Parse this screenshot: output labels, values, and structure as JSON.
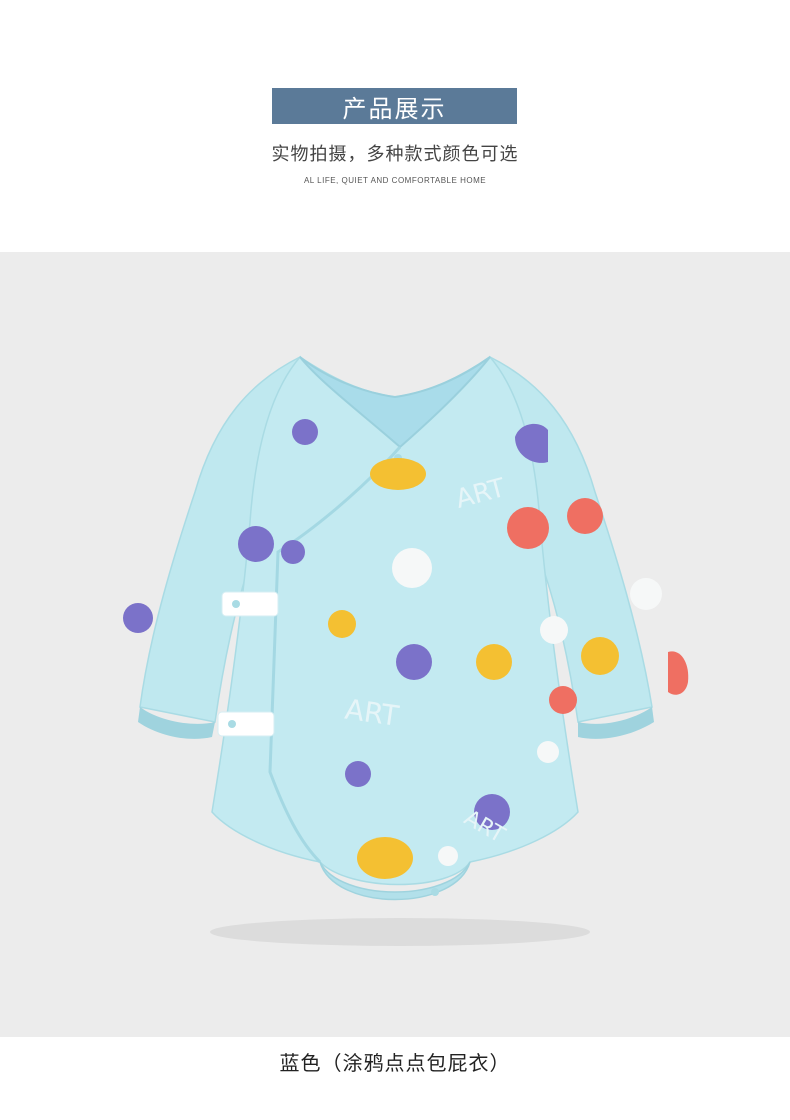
{
  "header": {
    "title": "产品展示",
    "subtitle": "实物拍摄，多种款式颜色可选",
    "tagline": "AL LIFE, QUIET AND COMFORTABLE HOME"
  },
  "product": {
    "caption": "蓝色（涂鸦点点包屁衣）",
    "print_text": "ART"
  },
  "colors": {
    "title_bar": "#5b7a98",
    "garment": "#bfe8ef",
    "dot_purple": "#7b72c9",
    "dot_yellow": "#f4c032",
    "dot_coral": "#ef6f62",
    "dot_white": "#f6f8f8"
  }
}
